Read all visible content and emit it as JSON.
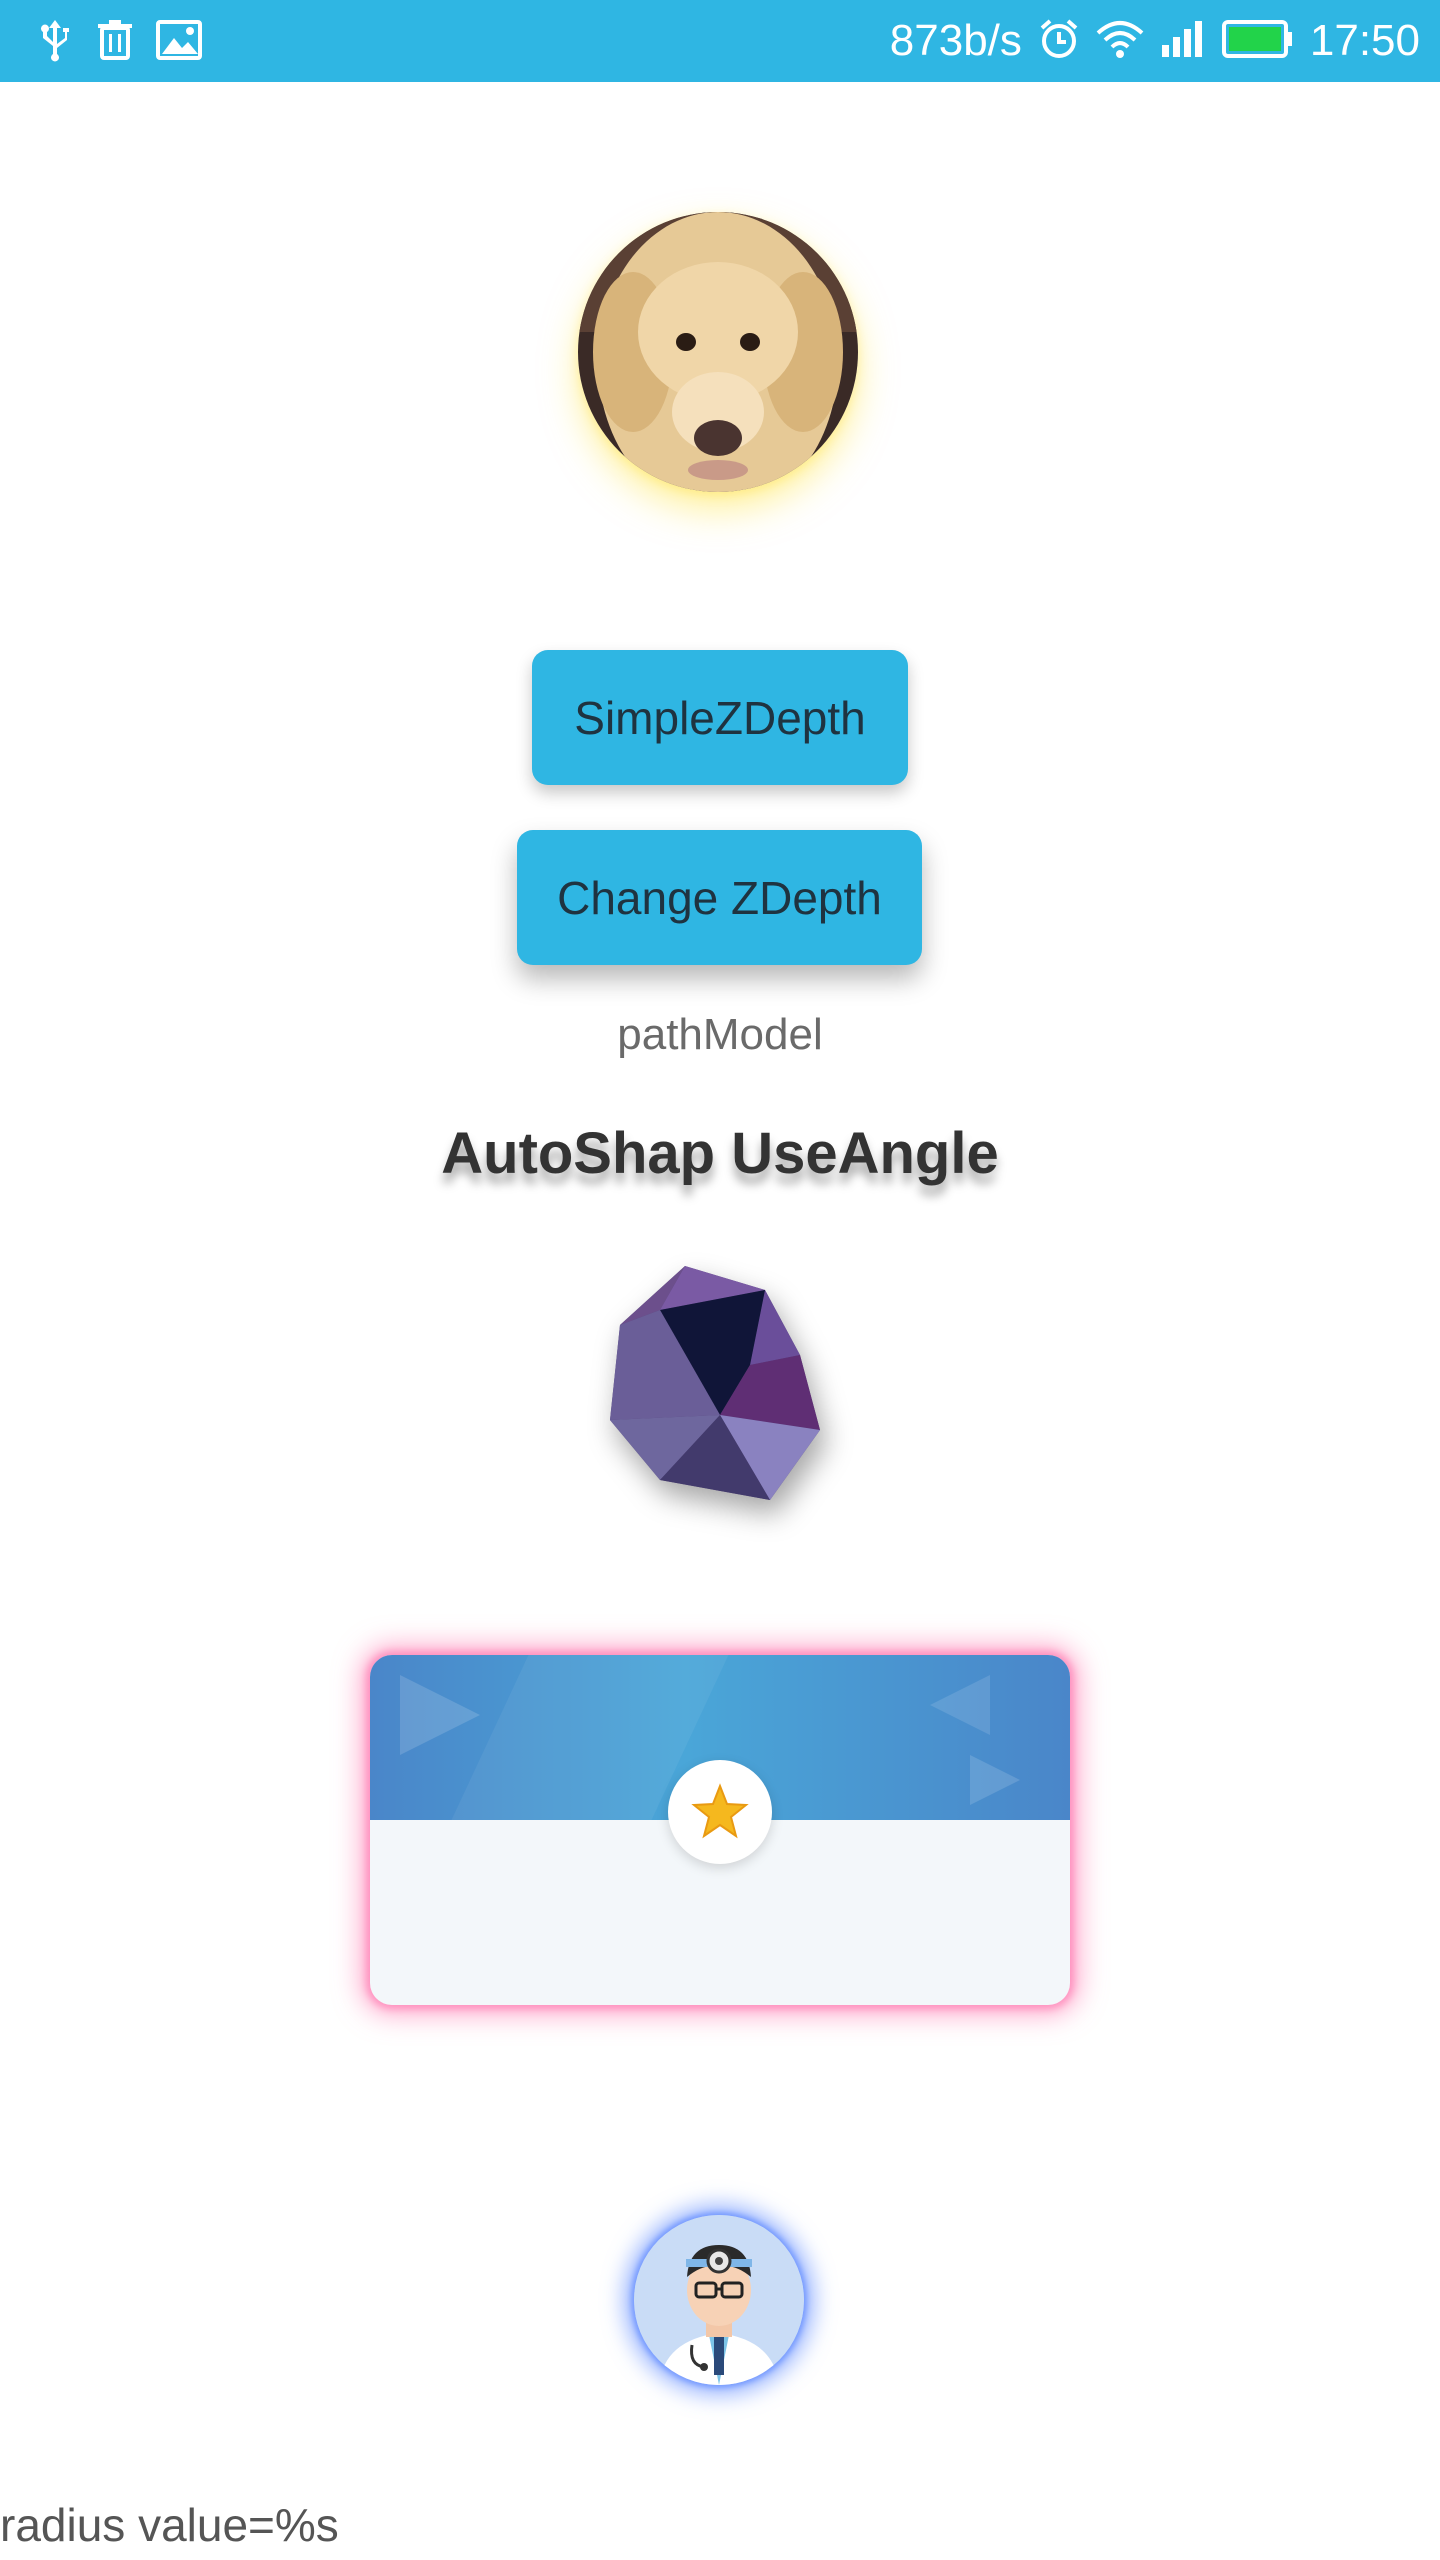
{
  "status_bar": {
    "net_speed": "873b/s",
    "time": "17:50",
    "icons": [
      "usb-icon",
      "trash-icon",
      "image-icon",
      "alarm-icon",
      "wifi-icon",
      "signal-icon",
      "battery-icon"
    ],
    "bg_color": "#2fb6e3"
  },
  "main": {
    "avatar_alt": "dog-avatar",
    "buttons": {
      "simple": "SimpleZDepth",
      "change": "Change ZDepth"
    },
    "path_label": "pathModel",
    "auto_shape_title": "AutoShap UseAngle",
    "gem_icon": "gem-icon",
    "card_icon": "star-icon",
    "doctor_avatar": "doctor-avatar",
    "radius_label": "radius  value=%s"
  },
  "colors": {
    "accent": "#2fb6e3",
    "card_glow": "#ff6ea6",
    "doctor_glow": "#4678ff",
    "dog_glow": "#ffe650"
  }
}
